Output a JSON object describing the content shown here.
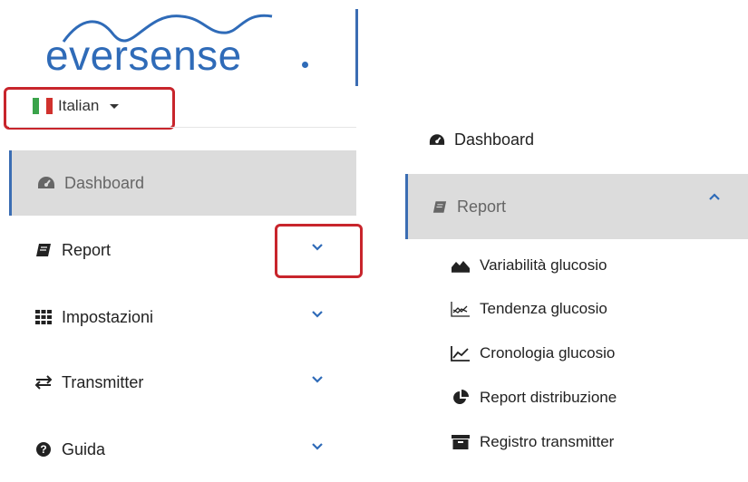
{
  "brand": {
    "logo_text": "eversense",
    "accent": "#2f6bb8"
  },
  "language": {
    "label": "Italian",
    "flag_colors": [
      "#3aa34a",
      "#ffffff",
      "#d0312d"
    ]
  },
  "highlight_color": "#c8252c",
  "left_nav": {
    "items": [
      {
        "label": "Dashboard",
        "icon": "tachometer-icon",
        "active": true
      },
      {
        "label": "Report",
        "icon": "book-icon",
        "expandable": true
      },
      {
        "label": "Impostazioni",
        "icon": "grid-icon",
        "expandable": true
      },
      {
        "label": "Transmitter",
        "icon": "exchange-icon",
        "expandable": true
      },
      {
        "label": "Guida",
        "icon": "question-circle-icon",
        "expandable": true
      }
    ]
  },
  "right_nav": {
    "dashboard_label": "Dashboard",
    "report_label": "Report",
    "report_expanded": true,
    "submenu": [
      {
        "label": "Variabilità glucosio",
        "icon": "area-chart-icon"
      },
      {
        "label": "Tendenza glucosio",
        "icon": "trend-chart-icon"
      },
      {
        "label": "Cronologia glucosio",
        "icon": "line-chart-icon"
      },
      {
        "label": "Report distribuzione",
        "icon": "pie-chart-icon"
      },
      {
        "label": "Registro transmitter",
        "icon": "archive-icon"
      }
    ]
  }
}
